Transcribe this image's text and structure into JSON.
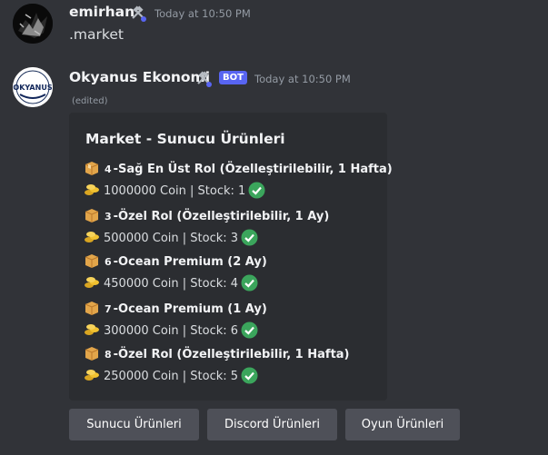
{
  "messages": [
    {
      "author": "emirhan",
      "timestamp": "Today at 10:50 PM",
      "text": ".market"
    },
    {
      "author": "Okyanus Ekonomi",
      "bot_tag": "BOT",
      "timestamp": "Today at 10:50 PM",
      "edited": "(edited)",
      "avatar_text": "OKYANUS"
    }
  ],
  "embed": {
    "title": "Market - Sunucu Ürünleri",
    "items": [
      {
        "number": "4",
        "title": "-Sağ En Üst Rol (Özelleştirilebilir, 1 Hafta)",
        "details": "1000000 Coin | Stock: 1"
      },
      {
        "number": "3",
        "title": "-Özel Rol (Özelleştirilebilir, 1 Ay)",
        "details": "500000 Coin | Stock: 3"
      },
      {
        "number": "6",
        "title": "-Ocean Premium (2 Ay)",
        "details": "450000 Coin | Stock: 4"
      },
      {
        "number": "7",
        "title": "-Ocean Premium (1 Ay)",
        "details": "300000 Coin | Stock: 6"
      },
      {
        "number": "8",
        "title": "-Özel Rol (Özelleştirilebilir, 1 Hafta)",
        "details": "250000 Coin | Stock: 5"
      }
    ]
  },
  "buttons": [
    {
      "label": "Sunucu Ürünleri"
    },
    {
      "label": "Discord Ürünleri"
    },
    {
      "label": "Oyun Ürünleri"
    }
  ],
  "colors": {
    "background": "#313338",
    "embed": "#2b2d31",
    "button": "#4e5058",
    "bot_tag": "#5865f2",
    "check": "#3ba55c"
  }
}
